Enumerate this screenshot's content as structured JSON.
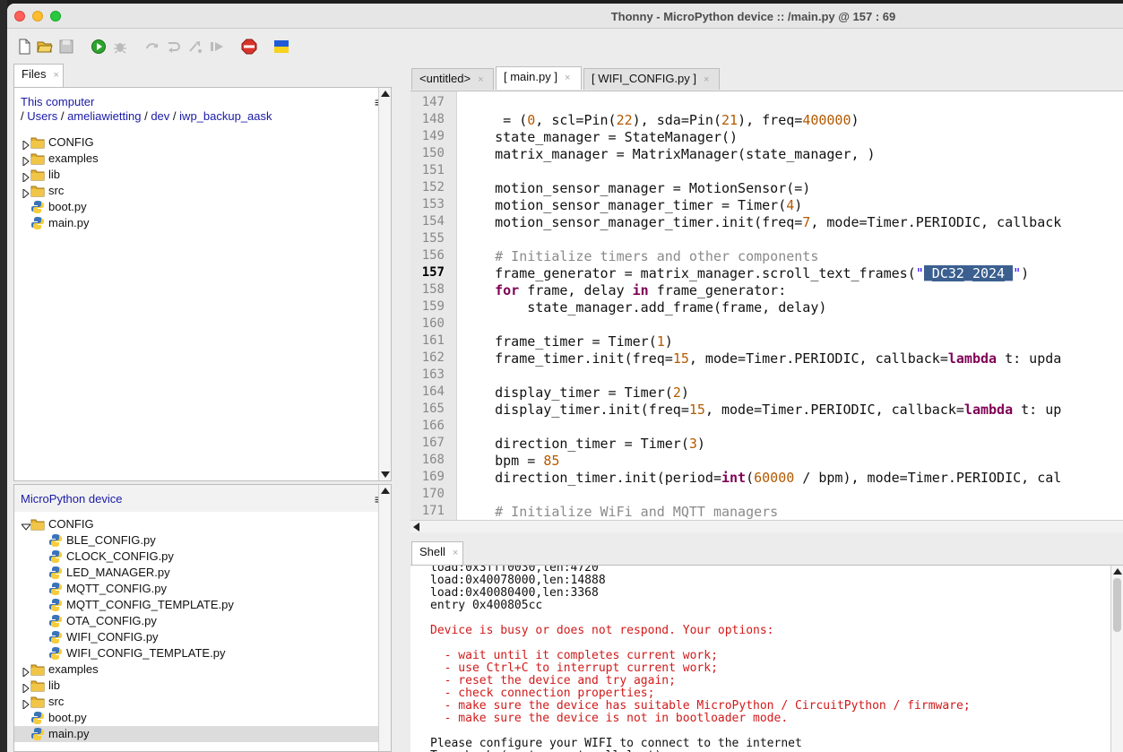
{
  "window": {
    "title": "Thonny  -  MicroPython device :: /main.py  @  157 : 69"
  },
  "toolbar": {
    "buttons": [
      "new-file-icon",
      "open-file-icon",
      "save-icon",
      "run-icon",
      "debug-icon",
      "step-over-icon",
      "step-into-icon",
      "step-out-icon",
      "resume-icon",
      "stop-icon",
      "ukraine-flag-icon"
    ]
  },
  "files_panel": {
    "tab": "Files",
    "computer": {
      "title": "This computer",
      "path_sep": "/",
      "path": [
        "Users",
        "ameliawietting",
        "dev",
        "iwp_backup_aask"
      ],
      "items": [
        {
          "name": "CONFIG",
          "type": "folder"
        },
        {
          "name": "examples",
          "type": "folder"
        },
        {
          "name": "lib",
          "type": "folder"
        },
        {
          "name": "src",
          "type": "folder"
        },
        {
          "name": "boot.py",
          "type": "py"
        },
        {
          "name": "main.py",
          "type": "py"
        }
      ]
    },
    "device": {
      "title": "MicroPython device",
      "config_folder": "CONFIG",
      "config_items": [
        "BLE_CONFIG.py",
        "CLOCK_CONFIG.py",
        "LED_MANAGER.py",
        "MQTT_CONFIG.py",
        "MQTT_CONFIG_TEMPLATE.py",
        "OTA_CONFIG.py",
        "WIFI_CONFIG.py",
        "WIFI_CONFIG_TEMPLATE.py"
      ],
      "items": [
        {
          "name": "examples",
          "type": "folder"
        },
        {
          "name": "lib",
          "type": "folder"
        },
        {
          "name": "src",
          "type": "folder"
        },
        {
          "name": "boot.py",
          "type": "py"
        },
        {
          "name": "main.py",
          "type": "py",
          "selected": true
        }
      ]
    }
  },
  "editor": {
    "tabs": [
      "<untitled>",
      "[ main.py ]",
      "[ WIFI_CONFIG.py ]"
    ],
    "active_tab": "[ main.py ]",
    "current_line": 157,
    "lines": [
      {
        "n": "147",
        "t": ""
      },
      {
        "n": "148",
        "t": "    i2c = I2C(0, scl=Pin(22), sda=Pin(21), freq=400000)"
      },
      {
        "n": "149",
        "t": "    state_manager = StateManager()"
      },
      {
        "n": "150",
        "t": "    matrix_manager = MatrixManager(state_manager, i2c)"
      },
      {
        "n": "151",
        "t": ""
      },
      {
        "n": "152",
        "t": "    motion_sensor_manager = MotionSensor(i2c=i2c)"
      },
      {
        "n": "153",
        "t": "    motion_sensor_manager_timer = Timer(4)"
      },
      {
        "n": "154",
        "t": "    motion_sensor_manager_timer.init(freq=7, mode=Timer.PERIODIC, callback"
      },
      {
        "n": "155",
        "t": ""
      },
      {
        "n": "156",
        "t": "    # Initialize timers and other components"
      },
      {
        "n": "157",
        "t": "    frame_generator = matrix_manager.scroll_text_frames(\"_DC32_2024_\")"
      },
      {
        "n": "158",
        "t": "    for frame, delay in frame_generator:"
      },
      {
        "n": "159",
        "t": "        state_manager.add_frame(frame, delay)"
      },
      {
        "n": "160",
        "t": ""
      },
      {
        "n": "161",
        "t": "    frame_timer = Timer(1)"
      },
      {
        "n": "162",
        "t": "    frame_timer.init(freq=15, mode=Timer.PERIODIC, callback=lambda t: upda"
      },
      {
        "n": "163",
        "t": ""
      },
      {
        "n": "164",
        "t": "    display_timer = Timer(2)"
      },
      {
        "n": "165",
        "t": "    display_timer.init(freq=15, mode=Timer.PERIODIC, callback=lambda t: up"
      },
      {
        "n": "166",
        "t": ""
      },
      {
        "n": "167",
        "t": "    direction_timer = Timer(3)"
      },
      {
        "n": "168",
        "t": "    bpm = 85"
      },
      {
        "n": "169",
        "t": "    direction_timer.init(period=int(60000 / bpm), mode=Timer.PERIODIC, cal"
      },
      {
        "n": "170",
        "t": ""
      },
      {
        "n": "171",
        "t": "    # Initialize WiFi and MQTT managers"
      }
    ]
  },
  "shell": {
    "tab": "Shell",
    "lines": [
      {
        "t": "load:0x3fff0030,len:4720",
        "err": false
      },
      {
        "t": "load:0x40078000,len:14888",
        "err": false
      },
      {
        "t": "load:0x40080400,len:3368",
        "err": false
      },
      {
        "t": "entry 0x400805cc",
        "err": false
      },
      {
        "t": "",
        "err": false
      },
      {
        "t": "Device is busy or does not respond. Your options:",
        "err": true
      },
      {
        "t": "",
        "err": false
      },
      {
        "t": "  - wait until it completes current work;",
        "err": true
      },
      {
        "t": "  - use Ctrl+C to interrupt current work;",
        "err": true
      },
      {
        "t": "  - reset the device and try again;",
        "err": true
      },
      {
        "t": "  - check connection properties;",
        "err": true
      },
      {
        "t": "  - make sure the device has suitable MicroPython / CircuitPython / firmware;",
        "err": true
      },
      {
        "t": "  - make sure the device is not in bootloader mode.",
        "err": true
      },
      {
        "t": "",
        "err": false
      },
      {
        "t": "Please configure your WIFI to connect to the internet",
        "err": false
      },
      {
        "t": "Traceback (most recent call last):",
        "err": false
      }
    ]
  }
}
